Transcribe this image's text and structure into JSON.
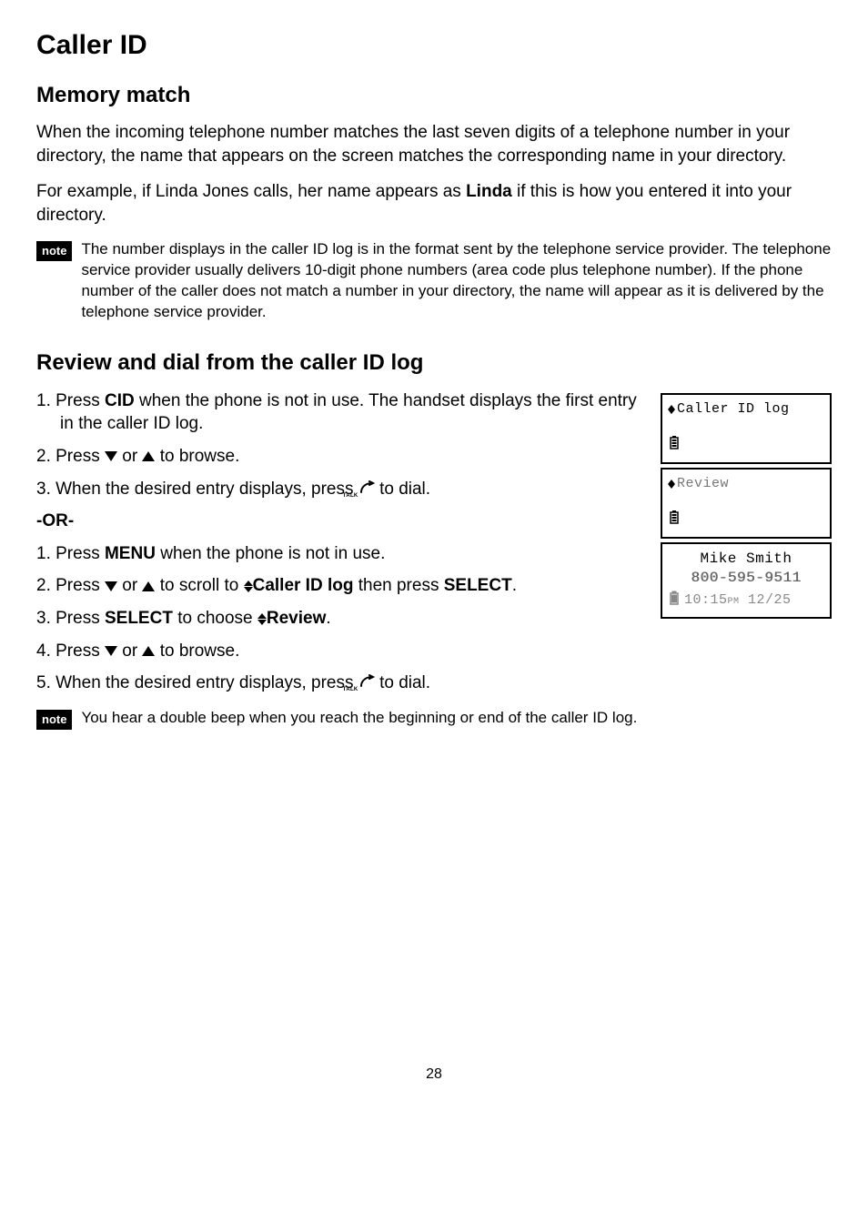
{
  "title": "Caller ID",
  "section1": {
    "heading": "Memory match",
    "p1": "When the incoming telephone number matches the last seven digits of a telephone number in your directory, the name that appears on the screen matches the corresponding name in your directory.",
    "p2a": "For example, if Linda Jones calls, her name appears as ",
    "p2b": "Linda",
    "p2c": " if this is how you entered it into your directory.",
    "noteLabel": "note",
    "noteText": "The number displays in the caller ID log is in the format sent by the telephone service provider. The telephone service provider usually delivers 10-digit phone numbers (area code plus telephone number). If the phone number of the caller does not match a number in your directory, the name will appear as it is delivered by the telephone service provider."
  },
  "section2": {
    "heading": "Review and dial from the caller ID log",
    "listA": {
      "i1a": "1. Press ",
      "i1b": "CID",
      "i1c": " when the phone is not in use. The handset displays the first entry in the caller ID log.",
      "i2a": "2. Press ",
      "i2b": " or ",
      "i2c": " to browse.",
      "i3a": "3. When the desired entry displays, press ",
      "i3b": " to dial."
    },
    "or": "-OR-",
    "listB": {
      "i1a": "1. Press ",
      "i1b": "MENU",
      "i1c": " when the phone is not in use.",
      "i2a": "2. Press ",
      "i2b": " or ",
      "i2c": " to scroll to ",
      "i2d": "Caller ID log",
      "i2e": " then press ",
      "i2f": "SELECT",
      "i2g": ".",
      "i3a": "3. Press ",
      "i3b": "SELECT",
      "i3c": " to choose ",
      "i3d": "Review",
      "i3e": ".",
      "i4a": "4. Press ",
      "i4b": " or ",
      "i4c": " to browse.",
      "i5a": "5. When the desired entry displays, press ",
      "i5b": " to dial."
    },
    "noteLabel": "note",
    "noteText": "You hear a double beep when you reach the beginning or end of the caller ID log."
  },
  "lcd": {
    "box1": "Caller ID log",
    "box2": "Review",
    "box3": {
      "name": "Mike Smith",
      "number": "800-595-9511",
      "time": "10:15",
      "pm": "PM",
      "date": "12/25"
    }
  },
  "pageNumber": "28"
}
